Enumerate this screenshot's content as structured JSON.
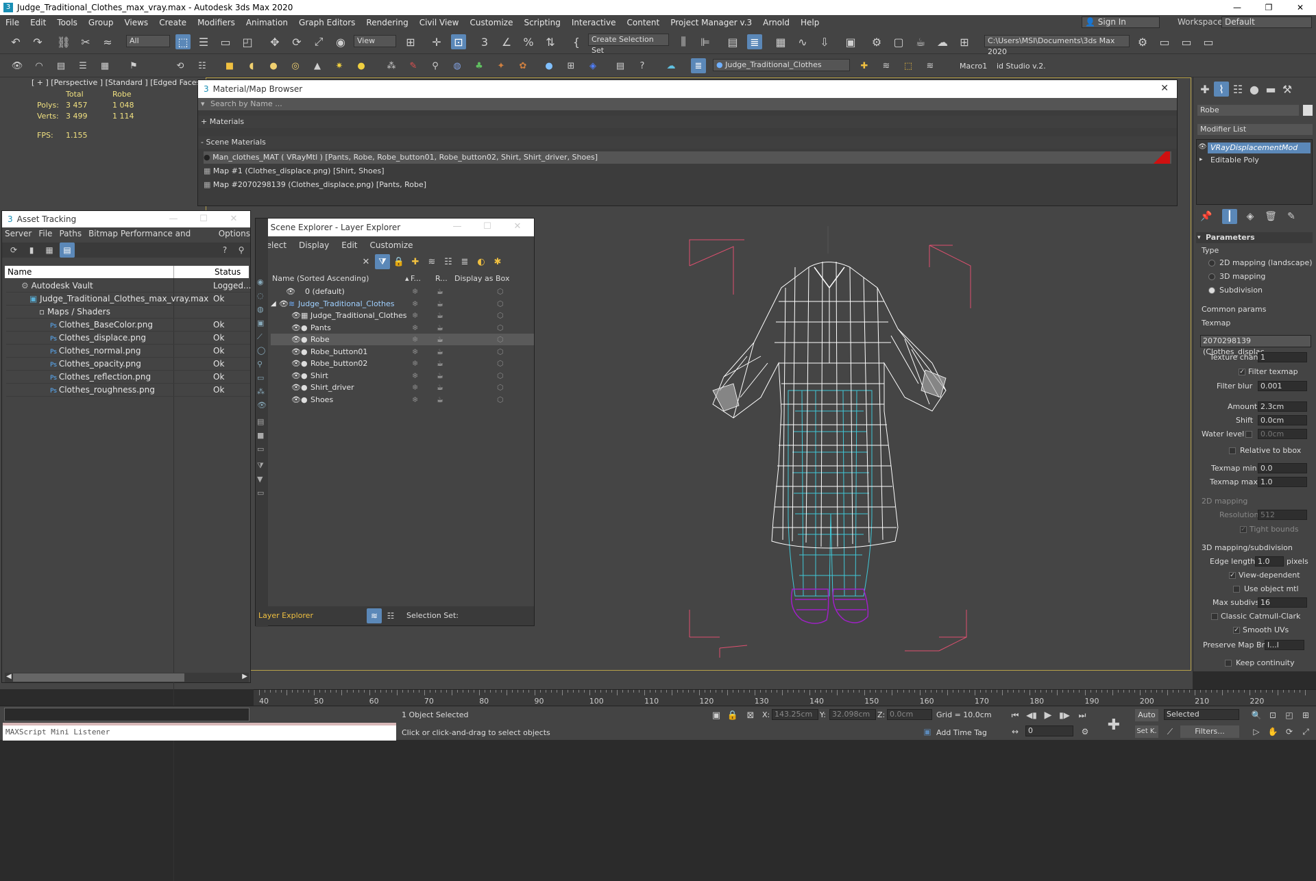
{
  "window": {
    "title": "Judge_Traditional_Clothes_max_vray.max - Autodesk 3ds Max 2020"
  },
  "menu": [
    "File",
    "Edit",
    "Tools",
    "Group",
    "Views",
    "Create",
    "Modifiers",
    "Animation",
    "Graph Editors",
    "Rendering",
    "Civil View",
    "Customize",
    "Scripting",
    "Interactive",
    "Content",
    "Project Manager v.3",
    "Arnold",
    "Help"
  ],
  "signin": {
    "label": "Sign In"
  },
  "workspaces": {
    "label": "Workspaces:",
    "value": "Default"
  },
  "toolbar": {
    "selection_filter": "All",
    "ref_coord": "View",
    "create_selection_set": "Create Selection Set",
    "project_path": "C:\\Users\\MSI\\Documents\\3ds Max 2020",
    "layer_dropdown": "Judge_Traditional_Clothes",
    "macro1": "Macro1",
    "studio": "id Studio v.2."
  },
  "viewport": {
    "label": "[ + ] [Perspective ]  [Standard ]  [Edged Faces ]",
    "stats": {
      "col_total": "Total",
      "col_robe": "Robe",
      "polys_label": "Polys:",
      "polys_total": "3 457",
      "polys_robe": "1 048",
      "verts_label": "Verts:",
      "verts_total": "3 499",
      "verts_robe": "1 114",
      "fps_label": "FPS:",
      "fps_value": "1.155"
    }
  },
  "material_browser": {
    "title": "Material/Map Browser",
    "search_placeholder": "Search by Name ...",
    "materials_group": "+ Materials",
    "scene_materials_group": "- Scene Materials",
    "items": [
      "Man_clothes_MAT  ( VRayMtl ) [Pants, Robe, Robe_button01, Robe_button02, Shirt, Shirt_driver, Shoes]",
      "Map #1 (Clothes_displace.png)  [Shirt, Shoes]",
      "Map #2070298139 (Clothes_displace.png)  [Pants, Robe]"
    ]
  },
  "asset_tracking": {
    "title": "Asset Tracking",
    "menu": [
      "Server",
      "File",
      "Paths",
      "Bitmap Performance and Memory",
      "Options"
    ],
    "col_name": "Name",
    "col_status": "Status",
    "rows": [
      {
        "name": "Autodesk Vault",
        "status": "Logged..."
      },
      {
        "name": "Judge_Traditional_Clothes_max_vray.max",
        "status": "Ok"
      },
      {
        "name": "Maps / Shaders",
        "status": ""
      },
      {
        "name": "Clothes_BaseColor.png",
        "status": "Ok"
      },
      {
        "name": "Clothes_displace.png",
        "status": "Ok"
      },
      {
        "name": "Clothes_normal.png",
        "status": "Ok"
      },
      {
        "name": "Clothes_opacity.png",
        "status": "Ok"
      },
      {
        "name": "Clothes_reflection.png",
        "status": "Ok"
      },
      {
        "name": "Clothes_roughness.png",
        "status": "Ok"
      }
    ]
  },
  "scene_explorer": {
    "title": "Scene Explorer - Layer Explorer",
    "menu": [
      "Select",
      "Display",
      "Edit",
      "Customize"
    ],
    "col_name": "Name (Sorted Ascending)",
    "col_f": "F...",
    "col_r": "R...",
    "col_box": "Display as Box",
    "rows": [
      {
        "name": "0 (default)",
        "level": 1
      },
      {
        "name": "Judge_Traditional_Clothes",
        "level": 0
      },
      {
        "name": "Judge_Traditional_Clothes",
        "level": 2
      },
      {
        "name": "Pants",
        "level": 2
      },
      {
        "name": "Robe",
        "level": 2
      },
      {
        "name": "Robe_button01",
        "level": 2
      },
      {
        "name": "Robe_button02",
        "level": 2
      },
      {
        "name": "Shirt",
        "level": 2
      },
      {
        "name": "Shirt_driver",
        "level": 2
      },
      {
        "name": "Shoes",
        "level": 2
      }
    ],
    "footer_explorer": "Layer Explorer",
    "footer_selset": "Selection Set:"
  },
  "command_panel": {
    "object_name": "Robe",
    "modifier_list": "Modifier List",
    "stack": [
      "VRayDisplacementMod",
      "Editable Poly"
    ],
    "rollout_title": "Parameters",
    "type_label": "Type",
    "type_options": [
      "2D mapping (landscape)",
      "3D mapping",
      "Subdivision"
    ],
    "common_params": "Common params",
    "texmap_label": "Texmap",
    "texmap_value": "2070298139 (Clothes_displac",
    "texture_chan_label": "Texture chan",
    "texture_chan_value": "1",
    "filter_texmap": "Filter texmap",
    "filter_blur_label": "Filter blur",
    "filter_blur_value": "0.001",
    "amount_label": "Amount",
    "amount_value": "2.3cm",
    "shift_label": "Shift",
    "shift_value": "0.0cm",
    "water_label": "Water level",
    "water_value": "0.0cm",
    "relative_bbox": "Relative to bbox",
    "texmap_min_label": "Texmap min",
    "texmap_min_value": "0.0",
    "texmap_max_label": "Texmap max",
    "texmap_max_value": "1.0",
    "mapping2d": "2D mapping",
    "resolution_label": "Resolution",
    "resolution_value": "512",
    "tight_bounds": "Tight bounds",
    "mapping3d": "3D mapping/subdivision",
    "edge_length_label": "Edge length",
    "edge_length_value": "1.0",
    "pixels": "pixels",
    "view_dependent": "View-dependent",
    "use_object_mtl": "Use object mtl",
    "max_subdivs_label": "Max subdivs",
    "max_subdivs_value": "16",
    "classic_catmull": "Classic Catmull-Clark",
    "smooth_uvs": "Smooth UVs",
    "preserve_map_label": "Preserve Map Bnd",
    "preserve_map_value": "I...l",
    "keep_continuity": "Keep continuity"
  },
  "timeline": {
    "ticks": [
      "40",
      "50",
      "60",
      "70",
      "80",
      "90",
      "100",
      "110",
      "120",
      "130",
      "140",
      "150",
      "160",
      "170",
      "180",
      "190",
      "200",
      "210",
      "220"
    ]
  },
  "status": {
    "listener": "MAXScript Mini Listener",
    "objects_selected": "1 Object Selected",
    "prompt": "Click or click-and-drag to select objects",
    "x_label": "X:",
    "x_value": "143.25cm",
    "y_label": "Y:",
    "y_value": "32.098cm",
    "z_label": "Z:",
    "z_value": "0.0cm",
    "grid": "Grid = 10.0cm",
    "add_time_tag": "Add Time Tag",
    "frame": "0",
    "auto": "Auto",
    "selected": "Selected",
    "setk": "Set K.",
    "filters": "Filters..."
  },
  "colors": {
    "accent": "#5b88b8",
    "viewport_border": "#b8a24a",
    "wire_white": "#ffffff",
    "wire_cyan": "#40c8d8",
    "wire_purple": "#a020c8",
    "bbox_pink": "#e05070"
  }
}
